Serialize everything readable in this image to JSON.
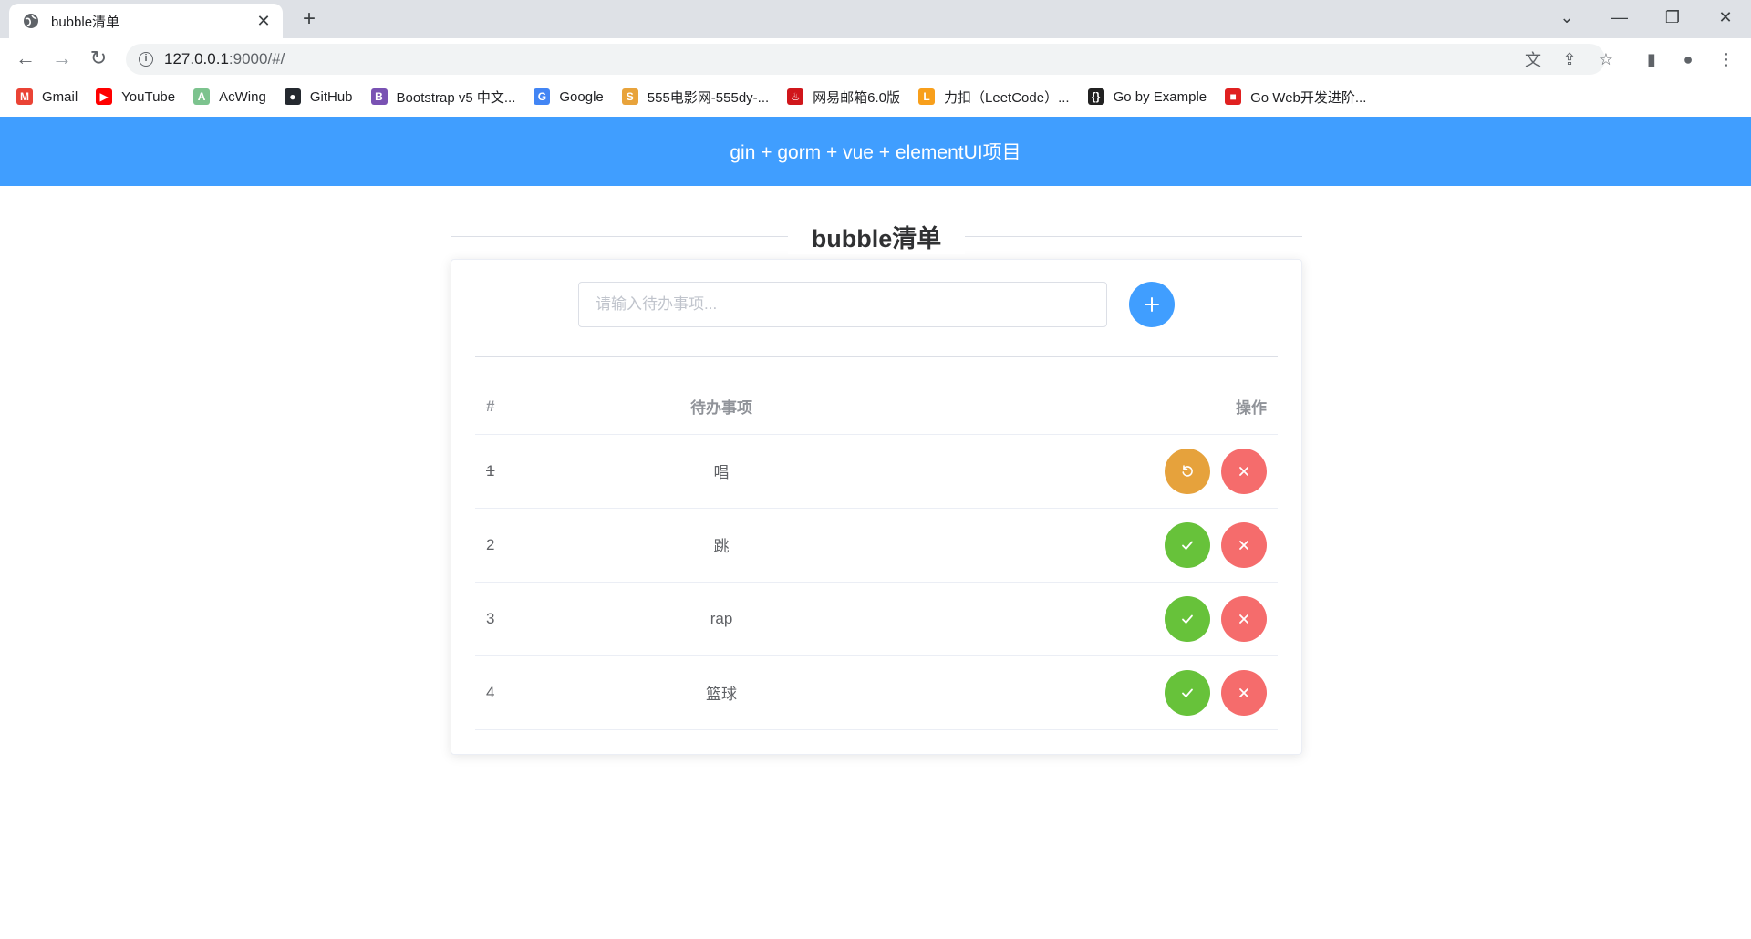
{
  "browser": {
    "tab_title": "bubble清单",
    "url_host": "127.0.0.1",
    "url_rest": ":9000/#/",
    "bookmarks": [
      {
        "label": "Gmail",
        "icon": "gmail-icon",
        "color": "#ea4335",
        "glyph": "M"
      },
      {
        "label": "YouTube",
        "icon": "youtube-icon",
        "color": "#ff0000",
        "glyph": "▶"
      },
      {
        "label": "AcWing",
        "icon": "acwing-icon",
        "color": "#7cc38e",
        "glyph": "A"
      },
      {
        "label": "GitHub",
        "icon": "github-icon",
        "color": "#24292f",
        "glyph": "●"
      },
      {
        "label": "Bootstrap v5 中文...",
        "icon": "bootstrap-icon",
        "color": "#7952b3",
        "glyph": "B"
      },
      {
        "label": "Google",
        "icon": "google-icon",
        "color": "#4285f4",
        "glyph": "G"
      },
      {
        "label": "555电影网-555dy-...",
        "icon": "555dy-icon",
        "color": "#e8a33b",
        "glyph": "S"
      },
      {
        "label": "网易邮箱6.0版",
        "icon": "netease-mail-icon",
        "color": "#d0161b",
        "glyph": "♨"
      },
      {
        "label": "力扣（LeetCode）...",
        "icon": "leetcode-icon",
        "color": "#f89f1b",
        "glyph": "L"
      },
      {
        "label": "Go by Example",
        "icon": "gobyexample-icon",
        "color": "#222222",
        "glyph": "{}"
      },
      {
        "label": "Go Web开发进阶...",
        "icon": "goweb-icon",
        "color": "#e02020",
        "glyph": "■"
      }
    ]
  },
  "page": {
    "header_title": "gin + gorm + vue + elementUI项目",
    "list_title": "bubble清单",
    "input": {
      "placeholder": "请输入待办事项...",
      "value": ""
    },
    "table": {
      "headers": {
        "index": "#",
        "title": "待办事项",
        "ops": "操作"
      },
      "rows": [
        {
          "index": "1",
          "title": "唱",
          "done": true
        },
        {
          "index": "2",
          "title": "跳",
          "done": false
        },
        {
          "index": "3",
          "title": "rap",
          "done": false
        },
        {
          "index": "4",
          "title": "篮球",
          "done": false
        }
      ]
    }
  },
  "colors": {
    "primary": "#409eff",
    "success": "#67c23a",
    "warning": "#e6a23c",
    "danger": "#f56c6c"
  }
}
